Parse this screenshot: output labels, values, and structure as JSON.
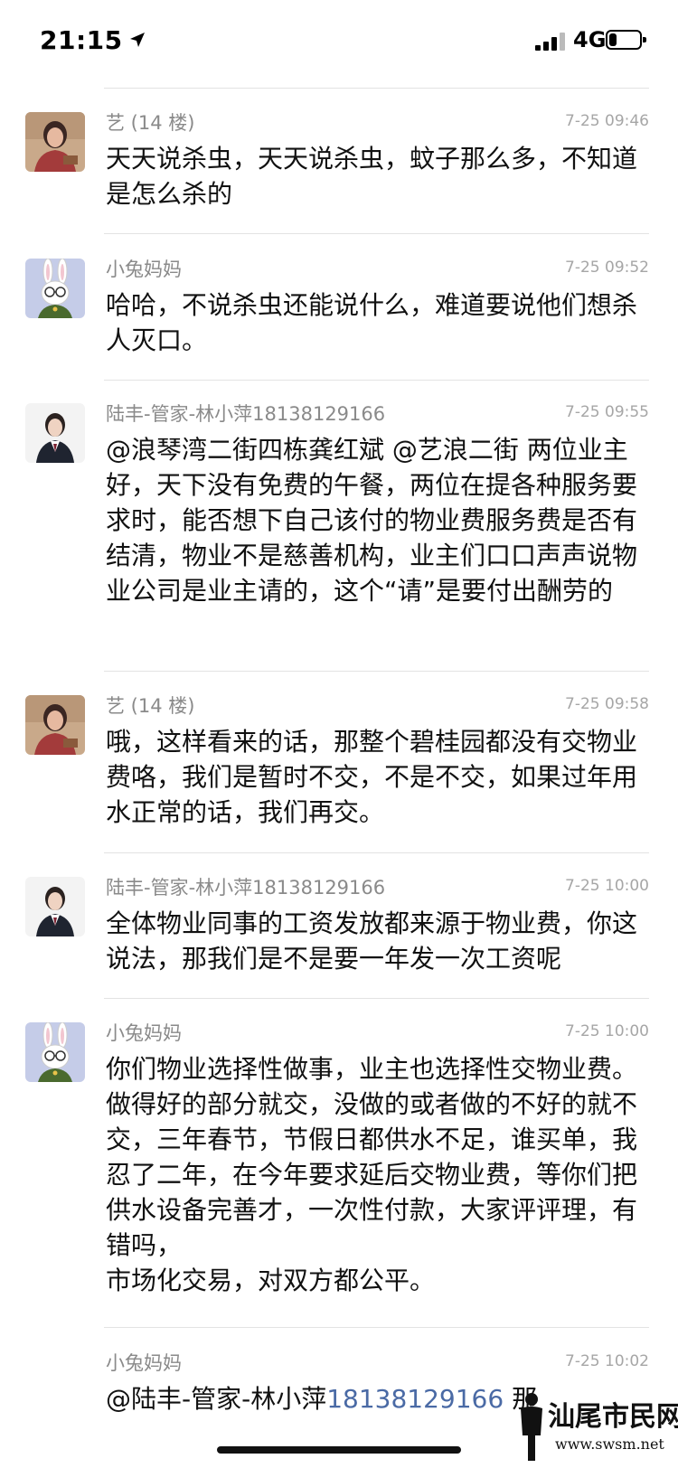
{
  "status_bar": {
    "time": "21:15",
    "location_icon": "location-arrow-icon",
    "network": "4G",
    "battery_level": 0.25
  },
  "messages": [
    {
      "name": "艺 (14 楼)",
      "time": "7-25 09:46",
      "avatar": "woman-photo",
      "text": "天天说杀虫，天天说杀虫，蚊子那么多，不知道是怎么杀的"
    },
    {
      "name": "小兔妈妈",
      "time": "7-25 09:52",
      "avatar": "bunny-cartoon",
      "text": "哈哈，不说杀虫还能说什么，难道要说他们想杀人灭口。"
    },
    {
      "name": "陆丰-管家-林小萍18138129166",
      "time": "7-25 09:55",
      "avatar": "staff-photo",
      "text": "@浪琴湾二街四栋龚红斌 @艺浪二街 两位业主好，天下没有免费的午餐，两位在提各种服务要求时，能否想下自己该付的物业费服务费是否有结清，物业不是慈善机构，业主们口口声声说物业公司是业主请的，这个“请”是要付出酬劳的"
    },
    {
      "name": "艺 (14 楼)",
      "time": "7-25 09:58",
      "avatar": "woman-photo",
      "text": "哦，这样看来的话，那整个碧桂园都没有交物业费咯，我们是暂时不交，不是不交，如果过年用水正常的话，我们再交。"
    },
    {
      "name": "陆丰-管家-林小萍18138129166",
      "time": "7-25 10:00",
      "avatar": "staff-photo",
      "text": "全体物业同事的工资发放都来源于物业费，你这说法，那我们是不是要一年发一次工资呢"
    },
    {
      "name": "小兔妈妈",
      "time": "7-25 10:00",
      "avatar": "bunny-cartoon",
      "text": "你们物业选择性做事，业主也选择性交物业费。做得好的部分就交，没做的或者做的不好的就不交，三年春节，节假日都供水不足，谁买单，我忍了二年，在今年要求延后交物业费，等你们把供水设备完善才，一次性付款，大家评评理，有错吗，\n市场化交易，对双方都公平。"
    },
    {
      "name": "小兔妈妈",
      "time": "7-25 10:02",
      "avatar": "bunny-cartoon",
      "text_prefix": "@陆丰-管家-林小萍",
      "text_phone": "18138129166",
      "text_suffix": " 那"
    }
  ],
  "watermark": {
    "brand": "汕尾市民网",
    "url": "www.swsm.net"
  }
}
